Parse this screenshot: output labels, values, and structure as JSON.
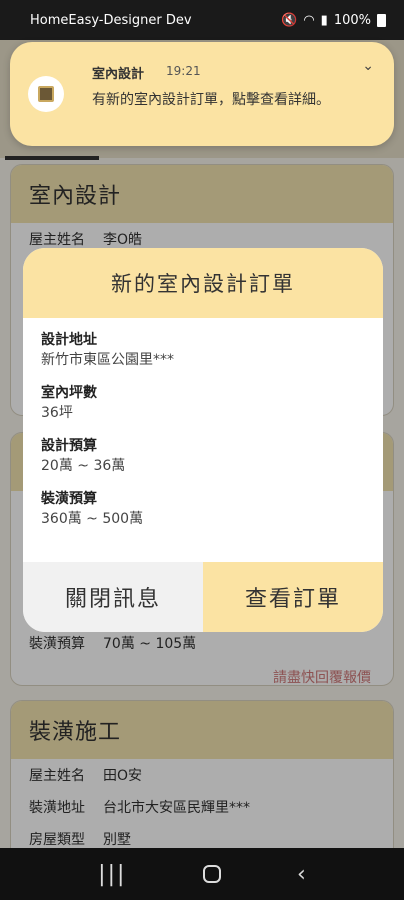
{
  "status_bar": {
    "carrier": "HomeEasy-Designer Dev",
    "battery": "100%"
  },
  "notification": {
    "app_name": "室內設計",
    "time": "19:21",
    "message": "有新的室內設計訂單，點擊查看詳細。"
  },
  "background": {
    "card1": {
      "title": "室內設計",
      "rows": [
        {
          "label": "屋主姓名",
          "value": "李O皓"
        }
      ]
    },
    "card2": {
      "rows": [
        {
          "label": "裝潢預算",
          "value": "70萬 ~ 105萬"
        }
      ],
      "quote_link": "請盡快回覆報價"
    },
    "card3": {
      "title": "裝潢施工",
      "rows": [
        {
          "label": "屋主姓名",
          "value": "田O安"
        },
        {
          "label": "裝潢地址",
          "value": "台北市大安區民輝里***"
        },
        {
          "label": "房屋類型",
          "value": "別墅"
        }
      ]
    }
  },
  "dialog": {
    "title": "新的室內設計訂單",
    "fields": [
      {
        "label": "設計地址",
        "value": "新竹市東區公園里***"
      },
      {
        "label": "室內坪數",
        "value": "36坪"
      },
      {
        "label": "設計預算",
        "value": "20萬 ~ 36萬"
      },
      {
        "label": "裝潢預算",
        "value": "360萬 ~ 500萬"
      }
    ],
    "close_label": "關閉訊息",
    "view_label": "查看訂單"
  },
  "colors": {
    "accent": "#fbe3a3",
    "card_header": "#f2e3b0",
    "link": "#d07a7a"
  }
}
